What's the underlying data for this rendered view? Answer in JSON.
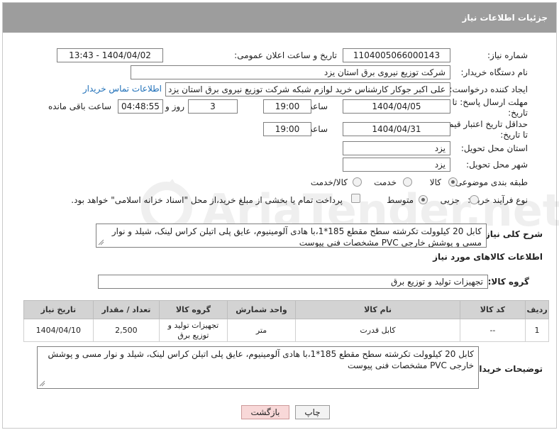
{
  "header": {
    "title": "جزئیات اطلاعات نیاز"
  },
  "fields": {
    "need_number_label": "شماره نیاز:",
    "need_number": "1104005066000143",
    "announce_label": "تاریخ و ساعت اعلان عمومی:",
    "announce_value": "1404/04/02 - 13:43",
    "buyer_org_label": "نام دستگاه خریدار:",
    "buyer_org": "شرکت توزیع نیروی برق استان یزد",
    "creator_label": "ایجاد کننده درخواست:",
    "creator": "علی اکبر  جوکار  کارشناس خرید لوازم شبکه   شرکت توزیع نیروی برق استان یزد",
    "contact_link": "اطلاعات تماس خریدار",
    "deadline_label_1": "مهلت ارسال پاسخ: تا",
    "deadline_label_2": "تاریخ:",
    "deadline_date": "1404/04/05",
    "time_label": "ساعت",
    "deadline_time": "19:00",
    "days_value": "3",
    "days_label": "روز و",
    "remaining_time": "04:48:55",
    "remaining_label": "ساعت باقی مانده",
    "validity_label_1": "حداقل تاریخ اعتبار قیمت:",
    "validity_label_2": "تا تاریخ:",
    "validity_date": "1404/04/31",
    "validity_time": "19:00",
    "province_label": "استان محل تحویل:",
    "province": "یزد",
    "city_label": "شهر محل تحویل:",
    "city": "یزد",
    "category_label": "طبقه بندی موضوعی:",
    "category_options": [
      "کالا",
      "خدمت",
      "کالا/خدمت"
    ],
    "category_selected": "کالا",
    "process_label": "نوع فرآیند خرید :",
    "process_options": [
      "جزیی",
      "متوسط"
    ],
    "process_selected": "متوسط",
    "payment_note": "پرداخت تمام یا بخشی از مبلغ خرید،از محل \"اسناد خزانه اسلامی\" خواهد بود."
  },
  "description": {
    "label": "شرح کلی نیاز:",
    "text": "کابل 20 کیلوولت تکرشته سطح مقطع 185*1،با هادی آلومینیوم، عایق پلی اتیلن کراس لینک، شیلد و نوار مسی و پوشش خارجی PVC مشخصات فنی پیوست"
  },
  "goods_section": {
    "title": "اطلاعات کالاهای مورد نیاز",
    "group_label": "گروه کالا:",
    "group_value": "تجهیزات تولید و توزیع برق"
  },
  "table": {
    "headers": [
      "ردیف",
      "کد کالا",
      "نام کالا",
      "واحد شمارش",
      "گروه کالا",
      "تعداد / مقدار",
      "تاریخ نیاز"
    ],
    "rows": [
      [
        "1",
        "--",
        "کابل قدرت",
        "متر",
        "تجهیزات تولید و توزیع برق",
        "2,500",
        "1404/04/10"
      ]
    ]
  },
  "buyer_notes": {
    "label": "توضیحات خریدار:",
    "text": "کابل 20 کیلوولت تکرشته سطح مقطع 185*1،با هادی آلومینیوم، عایق پلی اتیلن کراس لینک، شیلد و نوار مسی و پوشش خارجی PVC مشخصات فنی پیوست"
  },
  "buttons": {
    "print": "چاپ",
    "back": "بازگشت"
  },
  "watermark": "AriaTender.net"
}
